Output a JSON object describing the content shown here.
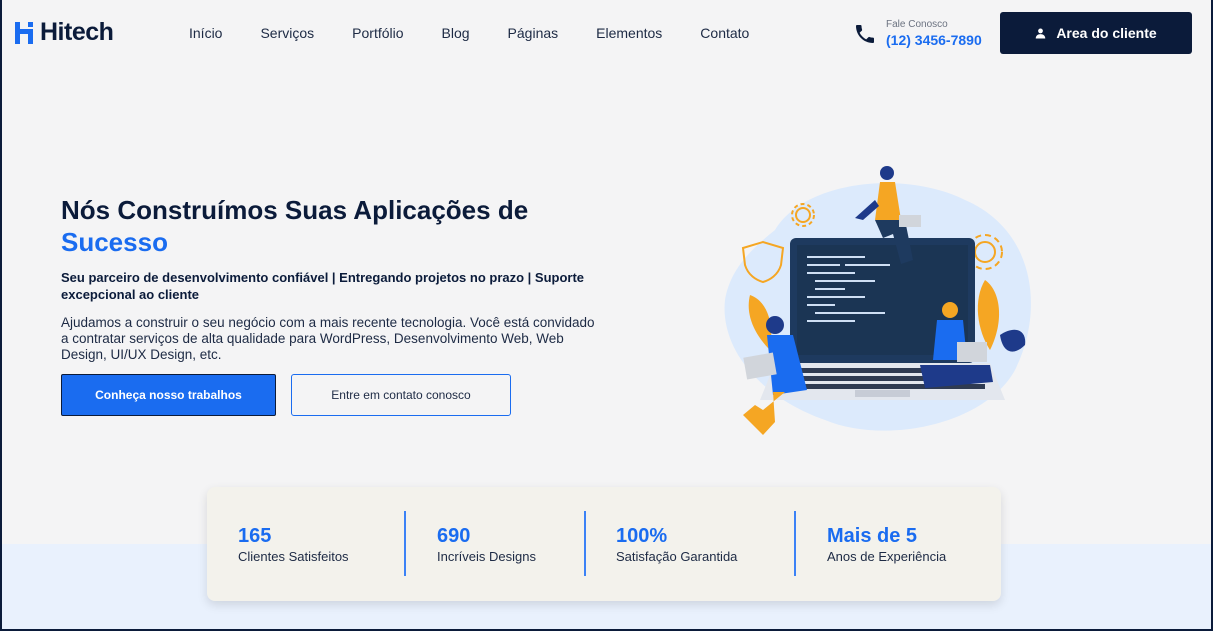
{
  "brand": {
    "name": "Hitech"
  },
  "nav": {
    "items": [
      {
        "label": "Início"
      },
      {
        "label": "Serviços"
      },
      {
        "label": "Portfólio"
      },
      {
        "label": "Blog"
      },
      {
        "label": "Páginas"
      },
      {
        "label": "Elementos"
      },
      {
        "label": "Contato"
      }
    ]
  },
  "contact": {
    "label": "Fale Conosco",
    "phone": "(12) 3456-7890",
    "icon": "phone-icon"
  },
  "client_area": {
    "label": "Area do cliente",
    "icon": "user-icon"
  },
  "hero": {
    "title_main": "Nós Construímos Suas Aplicações de ",
    "title_accent": "Sucesso",
    "subtitle": "Seu parceiro de desenvolvimento confiável | Entregando projetos no prazo | Suporte excepcional ao cliente",
    "description": "Ajudamos a construir o seu negócio com a mais recente tecnologia. Você está convidado a contratar serviços de alta qualidade para WordPress, Desenvolvimento Web, Web Design, UI/UX Design, etc.",
    "primary_button": "Conheça nosso trabalhos",
    "secondary_button": "Entre em contato conosco"
  },
  "stats": [
    {
      "value": "165",
      "label": "Clientes Satisfeitos"
    },
    {
      "value": "690",
      "label": "Incríveis Designs"
    },
    {
      "value": "100%",
      "label": "Satisfação Garantida"
    },
    {
      "value": "Mais de 5",
      "label": "Anos de Experiência"
    }
  ],
  "colors": {
    "primary": "#1a6cf0",
    "dark": "#0b1b3a",
    "background": "#f4f4f5",
    "accent_orange": "#f5a623"
  }
}
